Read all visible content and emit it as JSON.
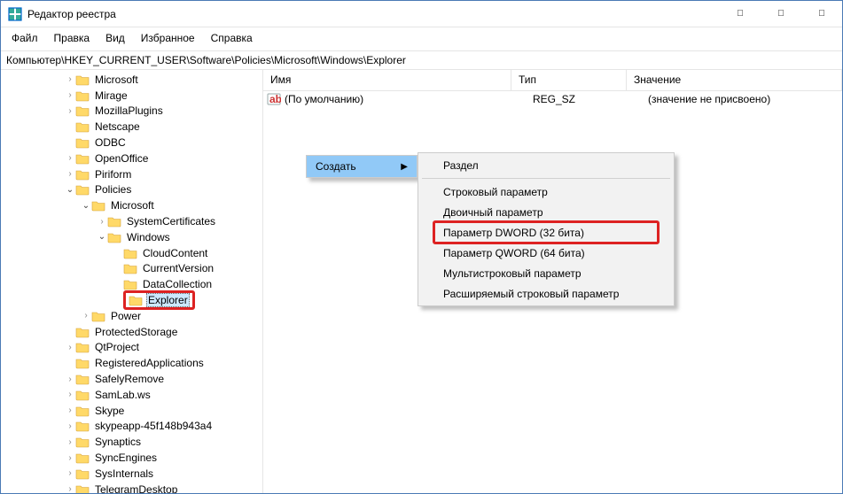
{
  "window": {
    "title": "Редактор реестра"
  },
  "menu": {
    "file": "Файл",
    "edit": "Правка",
    "view": "Вид",
    "favorites": "Избранное",
    "help": "Справка"
  },
  "address": "Компьютер\\HKEY_CURRENT_USER\\Software\\Policies\\Microsoft\\Windows\\Explorer",
  "columns": {
    "name": "Имя",
    "type": "Тип",
    "value": "Значение"
  },
  "default_value": {
    "name": "(По умолчанию)",
    "type": "REG_SZ",
    "value": "(значение не присвоено)"
  },
  "tree": [
    {
      "l": 4,
      "c": ">",
      "t": "Microsoft"
    },
    {
      "l": 4,
      "c": ">",
      "t": "Mirage"
    },
    {
      "l": 4,
      "c": ">",
      "t": "MozillaPlugins"
    },
    {
      "l": 4,
      "c": "",
      "t": "Netscape"
    },
    {
      "l": 4,
      "c": "",
      "t": "ODBC"
    },
    {
      "l": 4,
      "c": ">",
      "t": "OpenOffice"
    },
    {
      "l": 4,
      "c": ">",
      "t": "Piriform"
    },
    {
      "l": 4,
      "c": "v",
      "t": "Policies"
    },
    {
      "l": 5,
      "c": "v",
      "t": "Microsoft"
    },
    {
      "l": 6,
      "c": ">",
      "t": "SystemCertificates"
    },
    {
      "l": 6,
      "c": "v",
      "t": "Windows"
    },
    {
      "l": 7,
      "c": "",
      "t": "CloudContent"
    },
    {
      "l": 7,
      "c": "",
      "t": "CurrentVersion"
    },
    {
      "l": 7,
      "c": "",
      "t": "DataCollection"
    },
    {
      "l": 7,
      "c": "",
      "t": "Explorer",
      "sel": true,
      "hl": true
    },
    {
      "l": 5,
      "c": ">",
      "t": "Power"
    },
    {
      "l": 4,
      "c": "",
      "t": "ProtectedStorage"
    },
    {
      "l": 4,
      "c": ">",
      "t": "QtProject"
    },
    {
      "l": 4,
      "c": "",
      "t": "RegisteredApplications"
    },
    {
      "l": 4,
      "c": ">",
      "t": "SafelyRemove"
    },
    {
      "l": 4,
      "c": ">",
      "t": "SamLab.ws"
    },
    {
      "l": 4,
      "c": ">",
      "t": "Skype"
    },
    {
      "l": 4,
      "c": ">",
      "t": "skypeapp-45f148b943a4"
    },
    {
      "l": 4,
      "c": ">",
      "t": "Synaptics"
    },
    {
      "l": 4,
      "c": ">",
      "t": "SyncEngines"
    },
    {
      "l": 4,
      "c": ">",
      "t": "SysInternals"
    },
    {
      "l": 4,
      "c": ">",
      "t": "TelegramDesktop"
    }
  ],
  "context": {
    "create": "Создать",
    "items": {
      "key": "Раздел",
      "string": "Строковый параметр",
      "binary": "Двоичный параметр",
      "dword": "Параметр DWORD (32 бита)",
      "qword": "Параметр QWORD (64 бита)",
      "multi": "Мультистроковый параметр",
      "expand": "Расширяемый строковый параметр"
    }
  }
}
